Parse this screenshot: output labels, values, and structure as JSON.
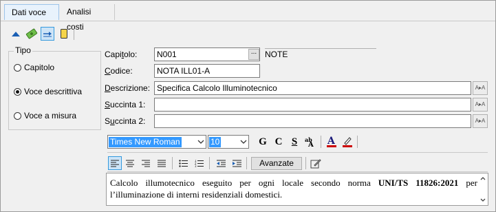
{
  "tabs": [
    {
      "label": "Dati voce",
      "active": true
    },
    {
      "label": "Analisi costi",
      "active": false
    }
  ],
  "toolbar": {
    "icons": [
      "move-up-icon",
      "money-icon",
      "indent-arrow-icon",
      "note-icon"
    ],
    "selected": "indent-arrow-icon"
  },
  "tipo": {
    "title": "Tipo",
    "options": [
      {
        "label": "Capitolo",
        "checked": false
      },
      {
        "label": "Voce descrittiva",
        "checked": true
      },
      {
        "label": "Voce a misura",
        "checked": false
      }
    ]
  },
  "fields": {
    "capitolo": {
      "label_pre": "Capi",
      "label_ul": "t",
      "label_post": "olo:",
      "value": "N001",
      "browse": "...",
      "note": "NOTE"
    },
    "codice": {
      "label_pre": "",
      "label_ul": "C",
      "label_post": "odice:",
      "value": "NOTA ILL01-A"
    },
    "descrizione": {
      "label_pre": "",
      "label_ul": "D",
      "label_post": "escrizione:",
      "value": "Specifica Calcolo Illuminotecnico"
    },
    "succinta1": {
      "label_pre": "",
      "label_ul": "S",
      "label_post": "uccinta 1:",
      "value": ""
    },
    "succinta2": {
      "label_pre": "S",
      "label_ul": "u",
      "label_post": "ccinta 2:",
      "value": ""
    }
  },
  "format": {
    "font": "Times New Roman",
    "size": "10",
    "bold": "G",
    "italic": "C",
    "strike": "S",
    "avanzate": "Avanzate"
  },
  "colors": {
    "accent": "#3399ff",
    "font_color": "#cc0000",
    "highlight": "#cc0000"
  },
  "editor": {
    "text_parts": [
      {
        "t": "Calcolo illumotecnico eseguito per ogni locale secondo norma ",
        "b": false
      },
      {
        "t": "UNI/TS 11826:2021",
        "b": true
      },
      {
        "t": " per l’illuminazione di interni residenziali domestici.",
        "b": false
      }
    ]
  }
}
